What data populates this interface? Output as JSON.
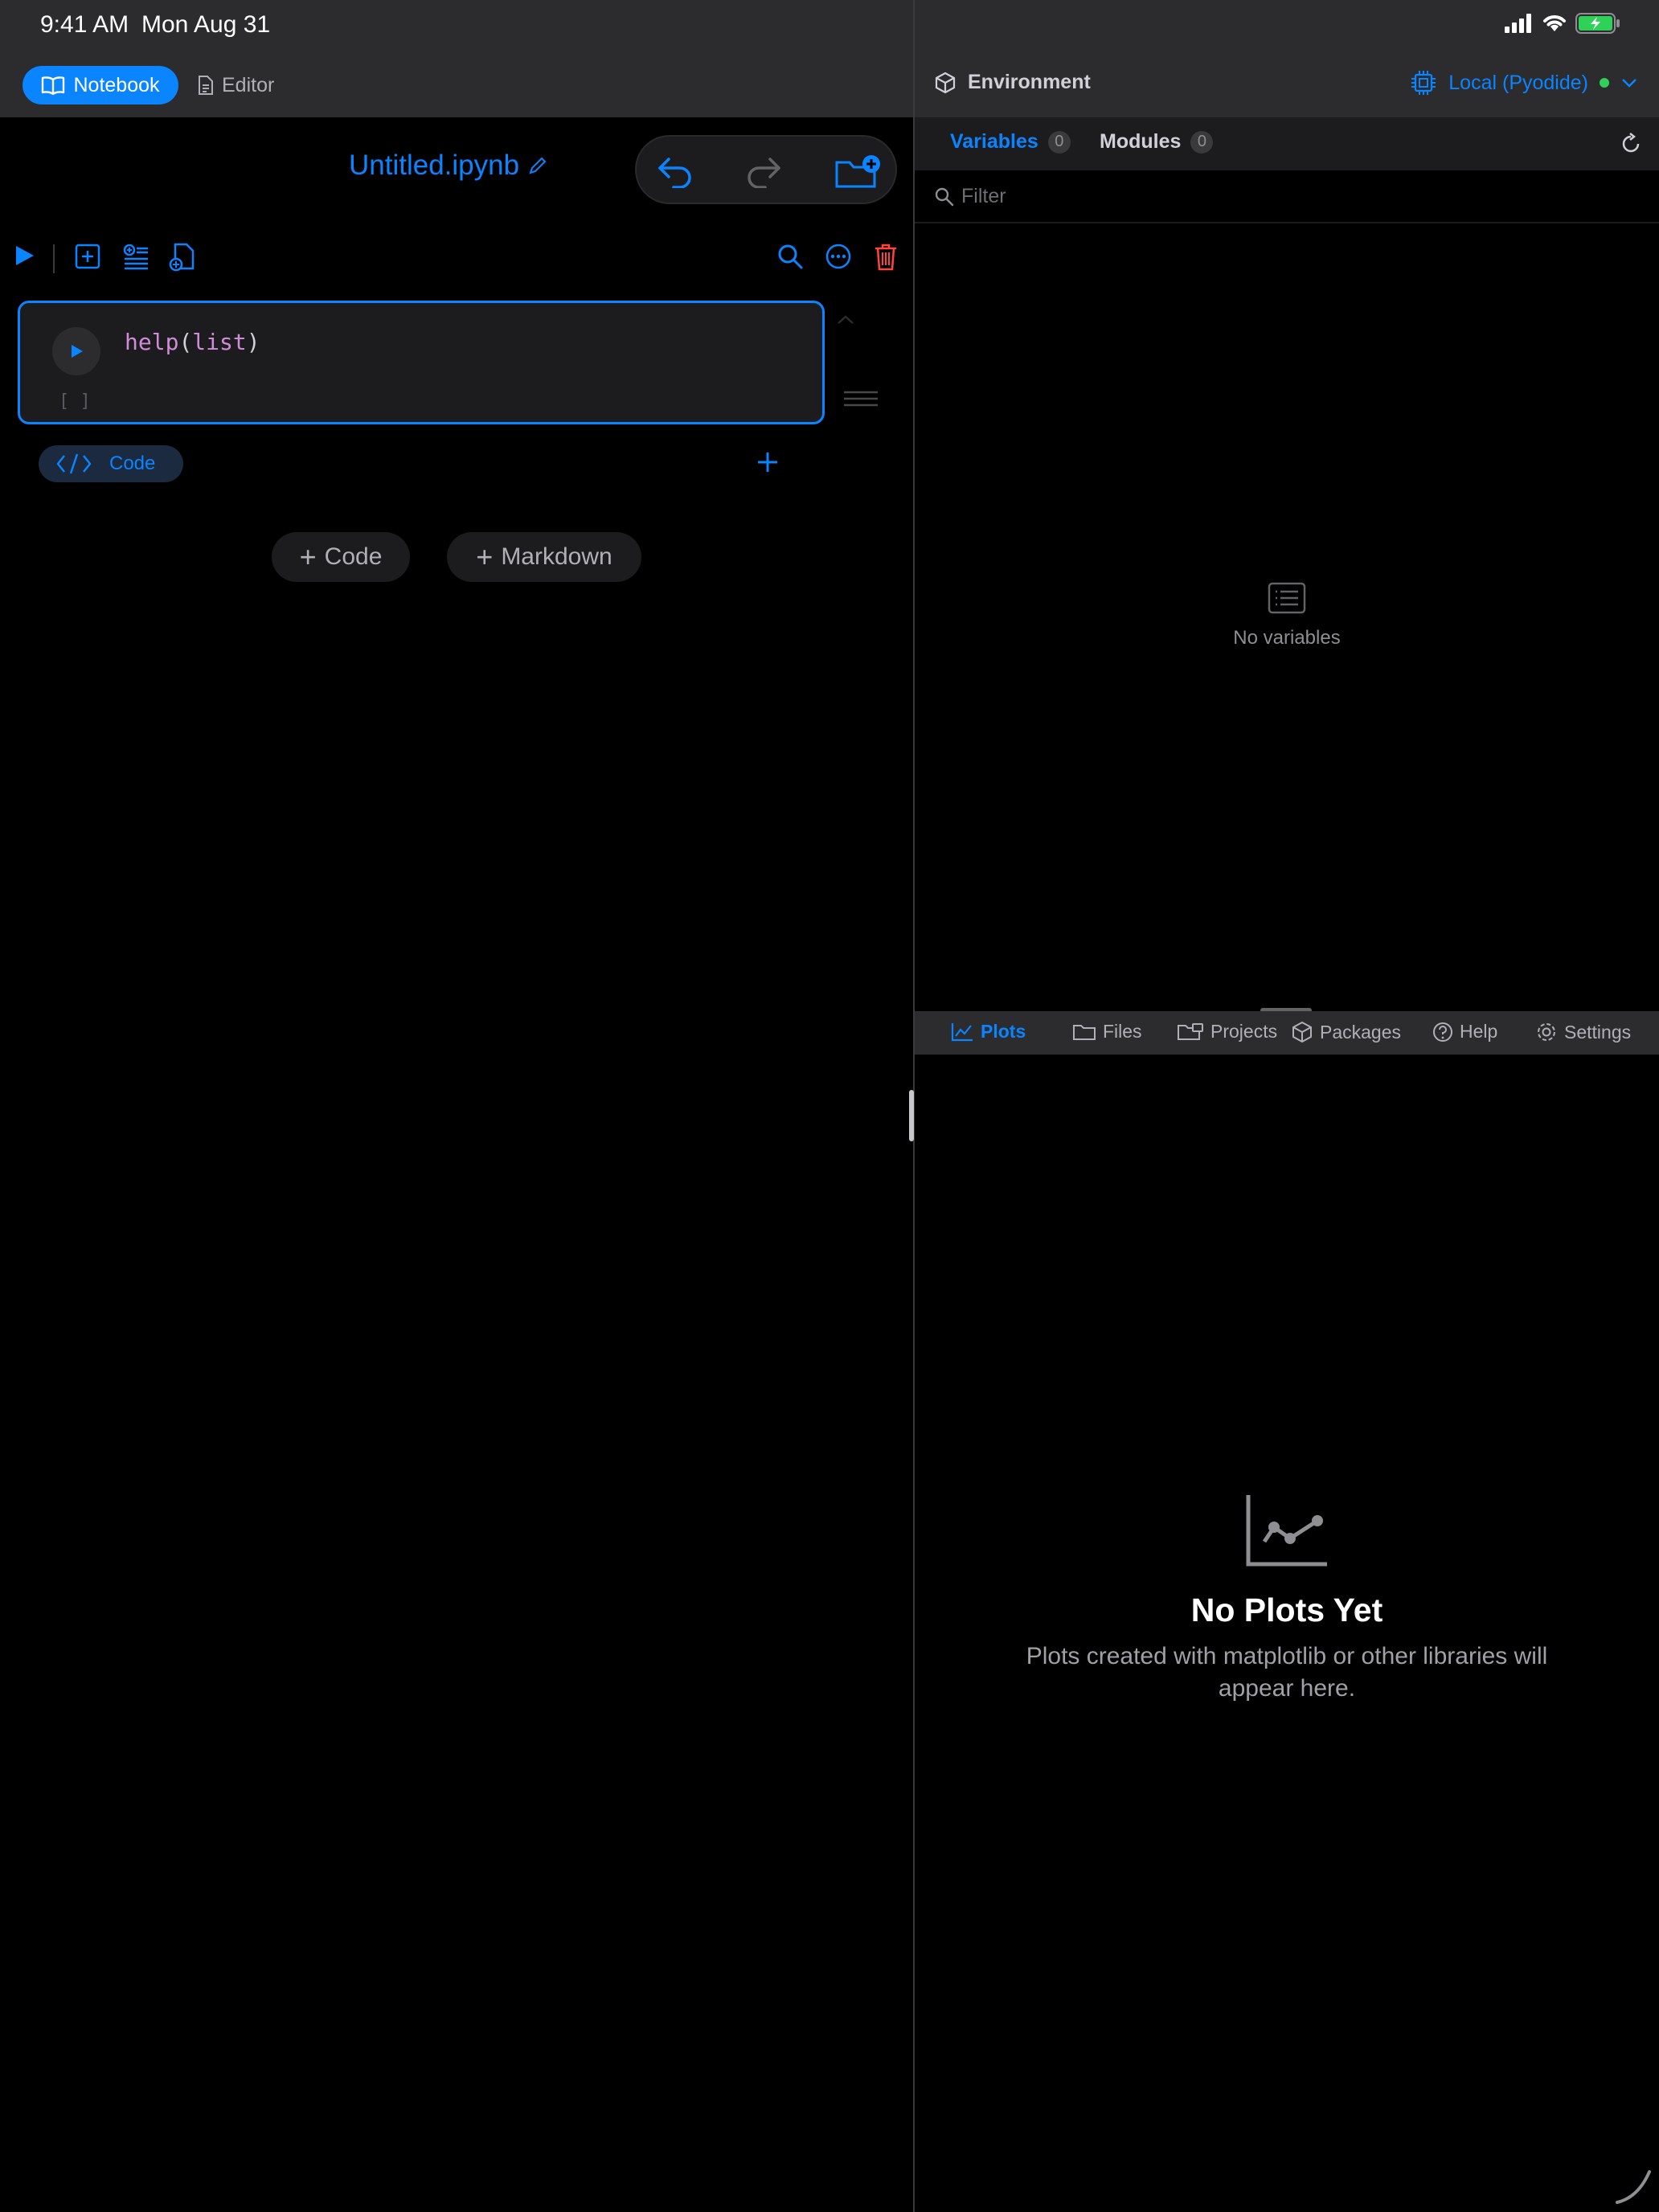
{
  "status_bar": {
    "time": "9:41 AM",
    "date": "Mon Aug 31"
  },
  "mode_switcher": {
    "notebook_label": "Notebook",
    "editor_label": "Editor"
  },
  "document": {
    "title": "Untitled.ipynb"
  },
  "cell": {
    "code_fn": "help",
    "code_open": "(",
    "code_arg": "list",
    "code_close": ")",
    "execution_count": "[ ]",
    "type_label": "Code"
  },
  "add_buttons": {
    "code": "Code",
    "markdown": "Markdown"
  },
  "environment": {
    "title": "Environment",
    "kernel_label": "Local (Pyodide)",
    "kernel_status_color": "#30d158"
  },
  "variables_tabs": {
    "variables_label": "Variables",
    "variables_count": "0",
    "modules_label": "Modules",
    "modules_count": "0"
  },
  "filter": {
    "placeholder": "Filter"
  },
  "variables_empty": {
    "text": "No variables"
  },
  "bottom_tabs": [
    {
      "label": "Plots",
      "icon": "chart-icon",
      "active": true
    },
    {
      "label": "Files",
      "icon": "folder-icon"
    },
    {
      "label": "Projects",
      "icon": "projects-folder-icon"
    },
    {
      "label": "Packages",
      "icon": "package-icon"
    },
    {
      "label": "Help",
      "icon": "help-icon"
    },
    {
      "label": "Settings",
      "icon": "gear-icon"
    }
  ],
  "plots_empty": {
    "title": "No Plots Yet",
    "subtitle": "Plots created with matplotlib or other libraries will appear here."
  },
  "colors": {
    "accent": "#0a84ff",
    "danger": "#ff453a",
    "background": "#000000",
    "bar": "#2c2c2e"
  }
}
